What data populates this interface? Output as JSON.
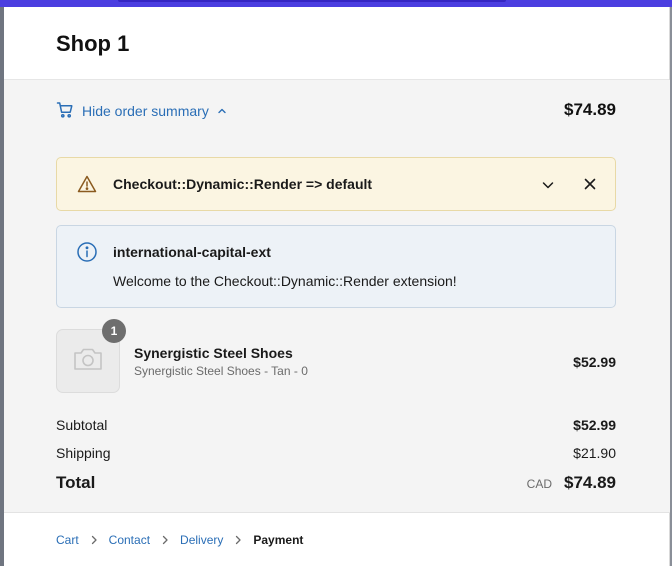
{
  "header": {
    "shop_title": "Shop 1"
  },
  "summary": {
    "toggle_label": "Hide order summary",
    "total": "$74.89",
    "icons": {
      "cart": "cart-icon",
      "toggle": "chevron-up-icon"
    }
  },
  "warning_banner": {
    "title": "Checkout::Dynamic::Render => default",
    "icons": {
      "status": "warning-icon",
      "expand": "chevron-down-icon",
      "close": "close-icon"
    }
  },
  "info_banner": {
    "title": "international-capital-ext",
    "message": "Welcome to the Checkout::Dynamic::Render extension!",
    "icons": {
      "status": "info-icon"
    }
  },
  "line_item": {
    "quantity": "1",
    "name": "Synergistic Steel Shoes",
    "variant": "Synergistic Steel Shoes - Tan - 0",
    "price": "$52.99",
    "icons": {
      "thumbnail": "camera-icon"
    }
  },
  "costs": {
    "subtotal_label": "Subtotal",
    "subtotal_value": "$52.99",
    "shipping_label": "Shipping",
    "shipping_value": "$21.90",
    "total_label": "Total",
    "currency": "CAD",
    "total_value": "$74.89"
  },
  "breadcrumb": {
    "items": [
      "Cart",
      "Contact",
      "Delivery",
      "Payment"
    ],
    "current": "Payment"
  },
  "colors": {
    "accent": "#2a6eb6",
    "top_bar": "#4b3ee0",
    "warning_bg": "#fbf5e2",
    "info_bg": "#edf2f7"
  }
}
